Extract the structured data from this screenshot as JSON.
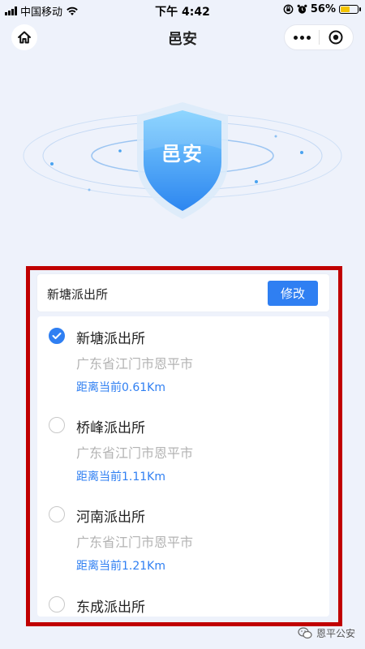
{
  "status_bar": {
    "carrier": "中国移动",
    "time": "下午 4:42",
    "battery": "56%",
    "battery_level": 0.56
  },
  "nav": {
    "title": "邑安"
  },
  "hero": {
    "shield_text": "邑安"
  },
  "search": {
    "value": "新塘派出所",
    "edit_label": "修改"
  },
  "stations": [
    {
      "name": "新塘派出所",
      "address": "广东省江门市恩平市",
      "distance": "距离当前0.61Km",
      "selected": true
    },
    {
      "name": "桥峰派出所",
      "address": "广东省江门市恩平市",
      "distance": "距离当前1.11Km",
      "selected": false
    },
    {
      "name": "河南派出所",
      "address": "广东省江门市恩平市",
      "distance": "距离当前1.21Km",
      "selected": false
    },
    {
      "name": "东成派出所",
      "address": "",
      "distance": "",
      "selected": false
    }
  ],
  "watermark": {
    "text": "恩平公安"
  },
  "colors": {
    "accent": "#2f7ff2",
    "frame": "#c00000",
    "background": "#eef2fb"
  }
}
